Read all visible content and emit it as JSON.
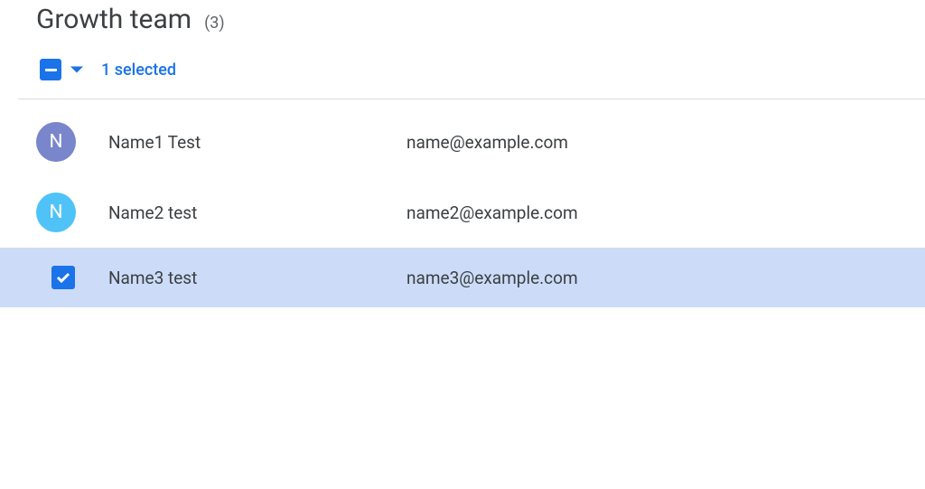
{
  "header": {
    "title": "Growth team",
    "count": "(3)"
  },
  "toolbar": {
    "selected_label": "1 selected"
  },
  "colors": {
    "accent": "#1a73e8",
    "avatar1": "#7986cb",
    "avatar2": "#4fc3f7",
    "selected_bg": "#ccdcf8"
  },
  "members": [
    {
      "initial": "N",
      "name": "Name1 Test",
      "email": "name@example.com",
      "selected": false,
      "avatar_color": "#7986cb"
    },
    {
      "initial": "N",
      "name": "Name2 test",
      "email": "name2@example.com",
      "selected": false,
      "avatar_color": "#4fc3f7"
    },
    {
      "initial": "",
      "name": "Name3 test",
      "email": "name3@example.com",
      "selected": true,
      "avatar_color": ""
    }
  ]
}
